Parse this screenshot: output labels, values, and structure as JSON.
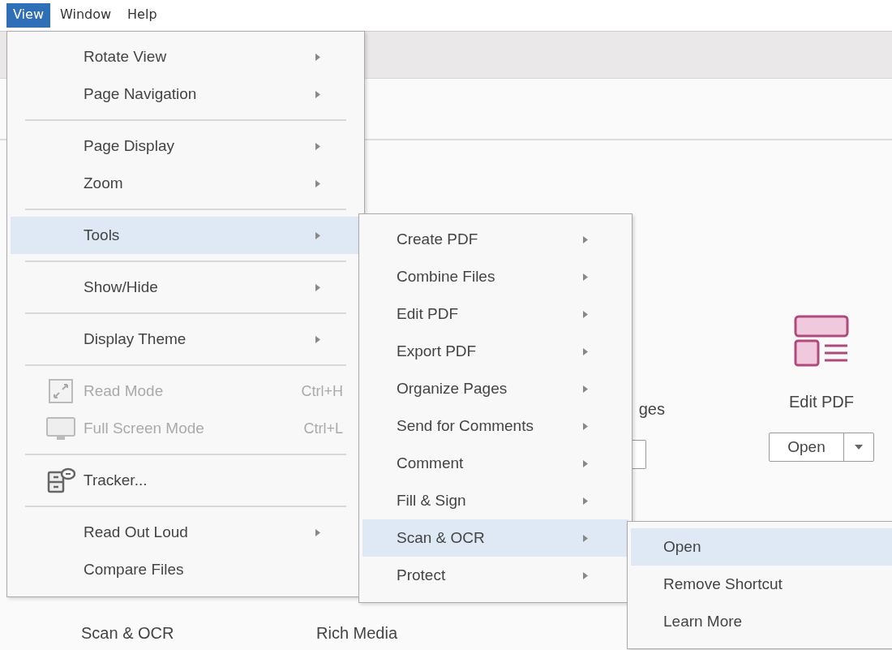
{
  "menu_bar": [
    {
      "label": "View",
      "selected": true
    },
    {
      "label": "Window",
      "selected": false
    },
    {
      "label": "Help",
      "selected": false
    }
  ],
  "tool_cards": [
    {
      "label": "ges",
      "kind": "clipped"
    },
    {
      "label": "Edit PDF",
      "kind": "full",
      "button": "Open"
    }
  ],
  "tool_list": [
    "Scan & OCR",
    "Rich Media"
  ],
  "view_menu": [
    {
      "kind": "submenu",
      "label": "Rotate View",
      "selected": false,
      "disabled": false
    },
    {
      "kind": "submenu",
      "label": "Page Navigation",
      "selected": false,
      "disabled": false
    },
    {
      "kind": "separator"
    },
    {
      "kind": "submenu",
      "label": "Page Display",
      "selected": false,
      "disabled": false
    },
    {
      "kind": "submenu",
      "label": "Zoom",
      "selected": false,
      "disabled": false
    },
    {
      "kind": "separator"
    },
    {
      "kind": "submenu",
      "label": "Tools",
      "selected": true,
      "disabled": false
    },
    {
      "kind": "separator"
    },
    {
      "kind": "submenu",
      "label": "Show/Hide",
      "selected": false,
      "disabled": false
    },
    {
      "kind": "separator"
    },
    {
      "kind": "submenu",
      "label": "Display Theme",
      "selected": false,
      "disabled": false
    },
    {
      "kind": "separator"
    },
    {
      "kind": "readmode",
      "label": "Read Mode",
      "selected": false,
      "disabled": true,
      "shortcut": "Ctrl+H"
    },
    {
      "kind": "fullscreen",
      "label": "Full Screen Mode",
      "selected": false,
      "disabled": true,
      "shortcut": "Ctrl+L"
    },
    {
      "kind": "separator"
    },
    {
      "kind": "tracker",
      "label": "Tracker...",
      "selected": false,
      "disabled": false
    },
    {
      "kind": "separator"
    },
    {
      "kind": "submenu",
      "label": "Read Out Loud",
      "selected": false,
      "disabled": false
    },
    {
      "kind": "command",
      "label": "Compare Files",
      "selected": false,
      "disabled": false
    }
  ],
  "tools_menu": [
    {
      "label": "Create PDF",
      "selected": false
    },
    {
      "label": "Combine Files",
      "selected": false
    },
    {
      "label": "Edit PDF",
      "selected": false
    },
    {
      "label": "Export PDF",
      "selected": false
    },
    {
      "label": "Organize Pages",
      "selected": false
    },
    {
      "label": "Send for Comments",
      "selected": false
    },
    {
      "label": "Comment",
      "selected": false
    },
    {
      "label": "Fill & Sign",
      "selected": false
    },
    {
      "label": "Scan & OCR",
      "selected": true
    },
    {
      "label": "Protect",
      "selected": false
    }
  ],
  "scan_menu": [
    {
      "label": "Open",
      "selected": true
    },
    {
      "label": "Remove Shortcut",
      "selected": false
    },
    {
      "label": "Learn More",
      "selected": false
    }
  ]
}
